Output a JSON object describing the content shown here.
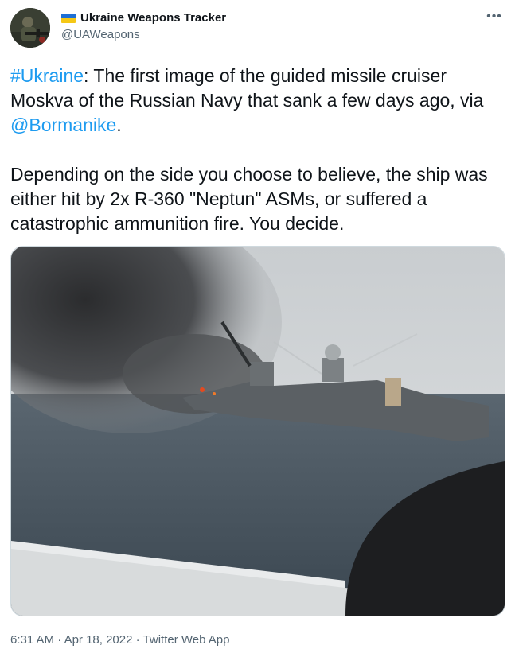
{
  "author": {
    "display_name": "Ukraine Weapons Tracker",
    "handle": "@UAWeapons",
    "flag_colors": {
      "top": "#1d6fd6",
      "bottom": "#f5c816"
    }
  },
  "more_icon": "more-horizontal-icon",
  "tweet": {
    "p1_hashtag": "#Ukraine",
    "p1_text": ": The first image of the guided missile cruiser Moskva of the Russian Navy that sank a few days ago, via ",
    "p1_mention": "@Bormanike",
    "p1_end": ".",
    "p2_text": "Depending on the side you choose to believe, the ship was either hit by 2x R-360 \"Neptun\" ASMs, or suffered a catastrophic ammunition fire. You decide."
  },
  "meta": {
    "time": "6:31 AM",
    "sep1": " · ",
    "date": "Apr 18, 2022",
    "sep2": " · ",
    "source": "Twitter Web App"
  },
  "colors": {
    "link": "#1d9bf0",
    "muted": "#536471",
    "text": "#0f1419"
  }
}
